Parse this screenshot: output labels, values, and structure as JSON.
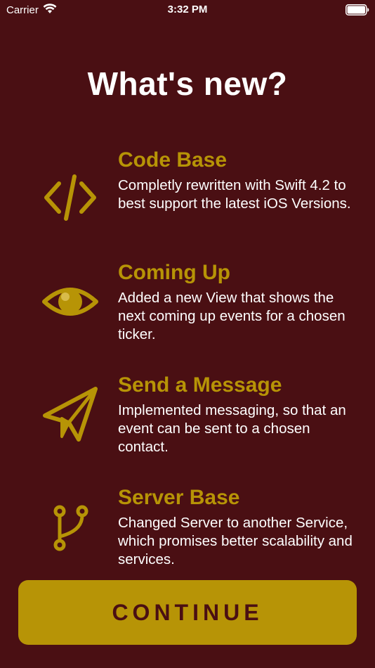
{
  "status_bar": {
    "carrier": "Carrier",
    "time": "3:32 PM"
  },
  "title": "What's new?",
  "accent_color": "#b79406",
  "background_color": "#4a0f13",
  "features": [
    {
      "icon": "code-icon",
      "title": "Code Base",
      "description": "Completly rewritten with Swift 4.2 to best support the latest iOS Versions."
    },
    {
      "icon": "eye-icon",
      "title": "Coming Up",
      "description": "Added a new View that shows the next coming up events for a chosen ticker."
    },
    {
      "icon": "paper-plane-icon",
      "title": "Send a Message",
      "description": "Implemented messaging, so that an event can be sent to a chosen contact."
    },
    {
      "icon": "branch-icon",
      "title": "Server Base",
      "description": "Changed Server to another Service, which promises better scalability and services."
    }
  ],
  "continue_label": "CONTINUE"
}
